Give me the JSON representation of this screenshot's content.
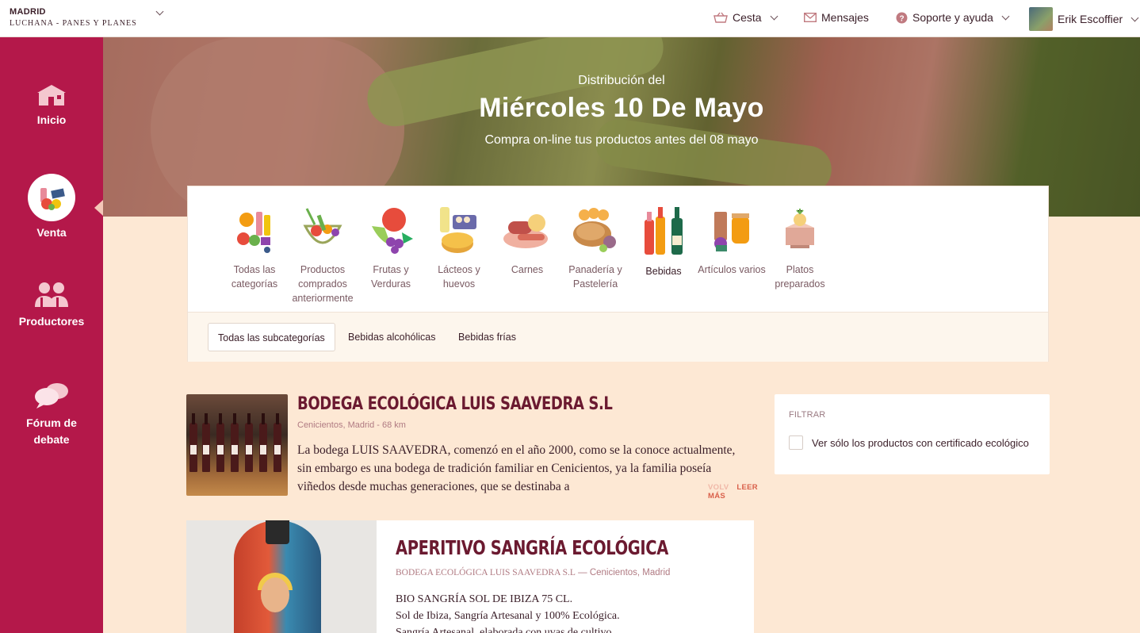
{
  "location": {
    "city": "MADRID",
    "group": "LUCHANA - PANES Y PLANES"
  },
  "topnav": {
    "basket": "Cesta",
    "messages": "Mensajes",
    "support": "Soporte y ayuda",
    "user": "Erik Escoffier"
  },
  "sidebar": {
    "items": [
      {
        "label": "Inicio"
      },
      {
        "label": "Venta"
      },
      {
        "label": "Productores"
      },
      {
        "label": "Fórum de debate"
      }
    ]
  },
  "hero": {
    "pre": "Distribución del",
    "date": "Miércoles 10 De Mayo",
    "sub": "Compra on-line tus productos antes del 08 mayo"
  },
  "categories": [
    {
      "label": "Todas las categorías"
    },
    {
      "label": "Productos comprados anteriormente"
    },
    {
      "label": "Frutas y Verduras"
    },
    {
      "label": "Lácteos y huevos"
    },
    {
      "label": "Carnes"
    },
    {
      "label": "Panadería y Pastelería"
    },
    {
      "label": "Bebidas"
    },
    {
      "label": "Artículos varios"
    },
    {
      "label": "Platos preparados"
    }
  ],
  "subcategories": [
    {
      "label": "Todas las subcategorías"
    },
    {
      "label": "Bebidas alcohólicas"
    },
    {
      "label": "Bebidas frías"
    }
  ],
  "producer": {
    "name": "BODEGA ECOLÓGICA LUIS SAAVEDRA S.L",
    "meta": "Cenicientos, Madrid - 68 km",
    "description": "La bodega LUIS SAAVEDRA, comenzó en el año 2000, como se la conoce actualmente, sin embargo es una bodega de tradición familiar en Cenicientos, ya la familia poseía viñedos desde muchas generaciones, que se destinaba a",
    "fade": "VOLV",
    "read_more": "LEER MÁS"
  },
  "filter": {
    "title": "FILTRAR",
    "option": "Ver sólo los productos con certificado ecológico"
  },
  "product": {
    "title": "APERITIVO SANGRÍA ECOLÓGICA",
    "producer": "BODEGA ECOLÓGICA LUIS SAAVEDRA S.L",
    "place": " — Cenicientos, Madrid",
    "lines": [
      "BIO SANGRÍA SOL DE IBIZA 75 CL.",
      "Sol de Ibiza, Sangría Artesanal y 100% Ecológica.",
      "Sangría Artesanal, elaborada con uvas de cultivo"
    ]
  },
  "colors": {
    "brand": "#b4184a",
    "background": "#fde8d4",
    "title": "#6b1a30"
  }
}
